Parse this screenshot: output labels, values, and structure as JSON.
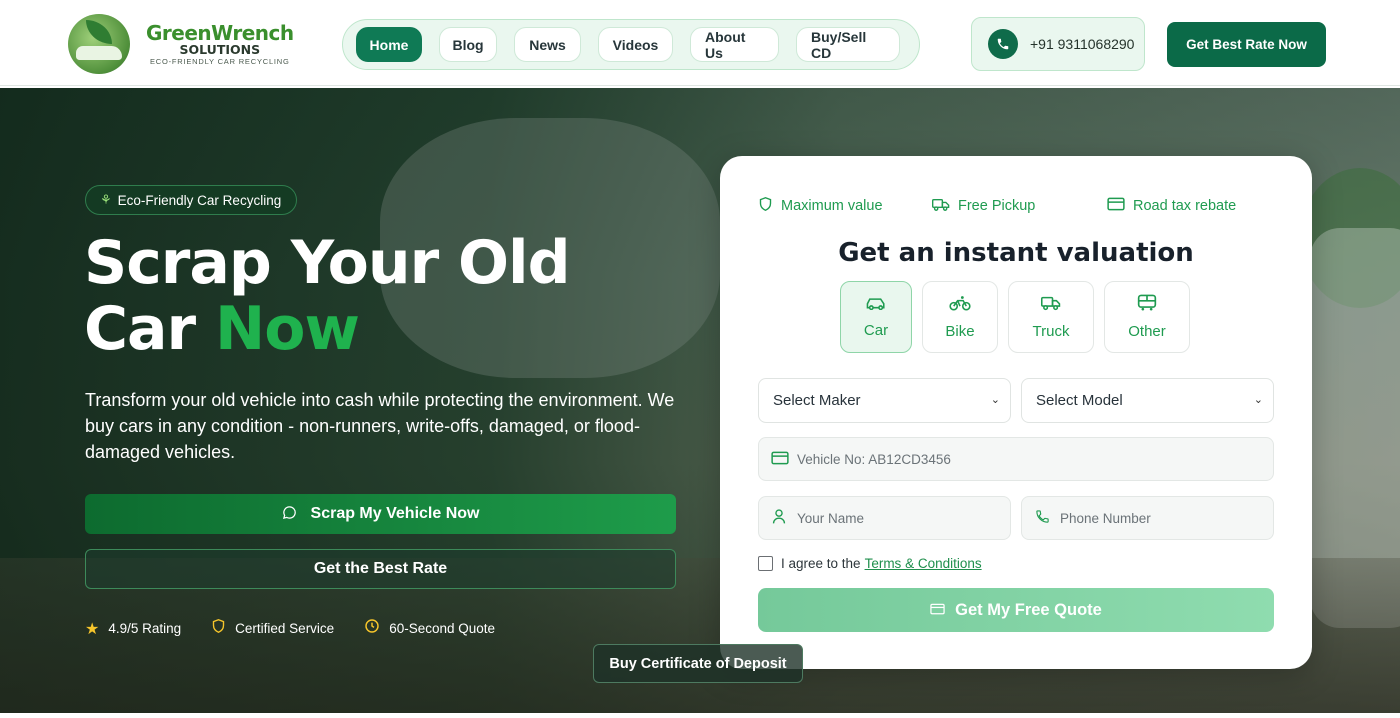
{
  "brand": {
    "title": "GreenWrench",
    "subtitle": "SOLUTIONS",
    "tagline": "ECO-FRIENDLY CAR RECYCLING"
  },
  "nav": {
    "items": [
      {
        "label": "Home",
        "active": true
      },
      {
        "label": "Blog"
      },
      {
        "label": "News"
      },
      {
        "label": "Videos"
      },
      {
        "label": "About Us"
      },
      {
        "label": "Buy/Sell CD"
      }
    ]
  },
  "header": {
    "phone": "+91 9311068290",
    "cta": "Get Best Rate Now"
  },
  "hero": {
    "badge": "Eco-Friendly Car Recycling",
    "title_line1": "Scrap Your Old",
    "title_line2_prefix": "Car",
    "title_line2_accent": "Now",
    "description": "Transform your old vehicle into cash while protecting the environment. We buy cars in any condition - non-runners, write-offs, damaged, or flood-damaged vehicles.",
    "primary_button": "Scrap My Vehicle Now",
    "secondary_button": "Get the Best Rate",
    "stats": [
      {
        "icon": "star-icon",
        "label": "4.9/5 Rating"
      },
      {
        "icon": "shield-icon",
        "label": "Certified Service"
      },
      {
        "icon": "clock-icon",
        "label": "60-Second Quote"
      }
    ],
    "deposit_button": "Buy Certificate of Deposit"
  },
  "form": {
    "features": [
      {
        "icon": "shield-icon",
        "label": "Maximum value"
      },
      {
        "icon": "truck-icon",
        "label": "Free Pickup"
      },
      {
        "icon": "card-icon",
        "label": "Road tax rebate"
      }
    ],
    "title": "Get an instant valuation",
    "vehicle_types": [
      {
        "icon": "car-icon",
        "label": "Car",
        "active": true
      },
      {
        "icon": "bike-icon",
        "label": "Bike"
      },
      {
        "icon": "truck-icon",
        "label": "Truck"
      },
      {
        "icon": "bus-icon",
        "label": "Other"
      }
    ],
    "maker_select": "Select Maker",
    "model_select": "Select Model",
    "vehicle_no_placeholder": "Vehicle No: AB12CD3456",
    "name_placeholder": "Your Name",
    "phone_placeholder": "Phone Number",
    "terms_prefix": "I agree to the",
    "terms_link": "Terms & Conditions",
    "submit": "Get My Free Quote"
  },
  "colors": {
    "brand_green": "#0f7a55",
    "accent_green": "#1fb24e",
    "star": "#f6c52b"
  }
}
